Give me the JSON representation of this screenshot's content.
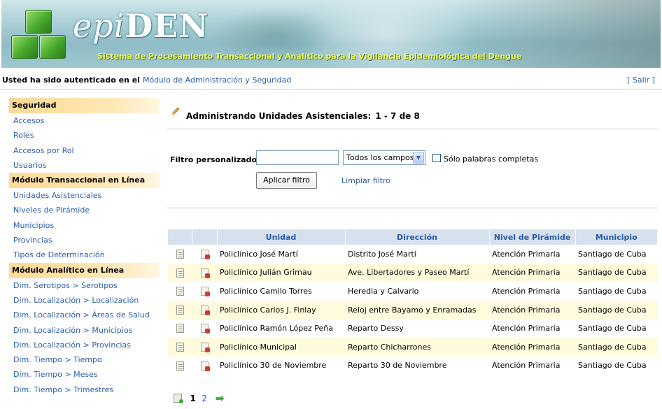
{
  "header": {
    "logo_prefix": "epi",
    "logo_suffix": "DEN",
    "subtitle": "Sistema de Procesamiento Transaccional y Analítico para la Vigilancia Epidemiológica del Dengue"
  },
  "auth": {
    "text": "Usted ha sido autenticado en el",
    "module": "Módulo de Administración y Seguridad",
    "logout": "[ Salir ]"
  },
  "sidebar": {
    "sections": [
      {
        "title": "Seguridad",
        "items": [
          "Accesos",
          "Roles",
          "Accesos por Rol",
          "Usuarios"
        ]
      },
      {
        "title": "Módulo Transaccional en Línea",
        "items": [
          "Unidades Asistenciales",
          "Niveles de Pirámide",
          "Municipios",
          "Provincias",
          "Tipos de Determinación"
        ]
      },
      {
        "title": "Módulo Analítico en Línea",
        "items": [
          "Dim. Serotipos > Serotipos",
          "Dim. Localización > Localización",
          "Dim. Localización > Áreas de Salud",
          "Dim. Localización > Municipios",
          "Dim. Localización > Provincias",
          "Dim. Tiempo > Tiempo",
          "Dim. Tiempo > Meses",
          "Dim. Tiempo > Trimestres"
        ]
      }
    ]
  },
  "main": {
    "title": "Administrando Unidades Asistenciales:",
    "range": "1 - 7 de 8",
    "filter": {
      "label": "Filtro personalizado",
      "input_value": "",
      "select_value": "Todos los campos",
      "checkbox_label": "Sólo palabras completas",
      "checkbox_checked": false,
      "apply": "Aplicar filtro",
      "clear": "Limpiar filtro"
    },
    "table": {
      "columns": [
        "Unidad",
        "Dirección",
        "Nivel de Pirámide",
        "Municipio"
      ],
      "rows": [
        [
          "Policlínico José Martí",
          "Distrito José Martí",
          "Atención Primaria",
          "Santiago de Cuba"
        ],
        [
          "Policlínico Julián Grimau",
          "Ave. Libertadores y Paseo Martí",
          "Atención Primaria",
          "Santiago de Cuba"
        ],
        [
          "Policlínico Camilo Torres",
          "Heredia y Calvario",
          "Atención Primaria",
          "Santiago de Cuba"
        ],
        [
          "Policlínico Carlos J. Finlay",
          "Reloj entre Bayamo y Enramadas",
          "Atención Primaria",
          "Santiago de Cuba"
        ],
        [
          "Policlínico Ramón López Peña",
          "Reparto Dessy",
          "Atención Primaria",
          "Santiago de Cuba"
        ],
        [
          "Policlínico Municipal",
          "Reparto Chicharrones",
          "Atención Primaria",
          "Santiago de Cuba"
        ],
        [
          "Policlínico 30 de Noviembre",
          "Reparto 30 de Noviembre",
          "Atención Primaria",
          "Santiago de Cuba"
        ]
      ]
    },
    "pager": {
      "current": "1",
      "pages": [
        "2"
      ]
    }
  },
  "colors": {
    "link": "#2a5ca8",
    "nav_header": "#ffd996",
    "table_header": "#d7e0ed",
    "row_alt": "#fffbdc",
    "subtitle": "#f4ff4a"
  },
  "icons": {
    "row_edit": "edit-icon",
    "row_delete": "delete-icon",
    "title": "pencil-icon",
    "pager_first": "new-record-icon",
    "pager_next": "next-arrow-icon"
  }
}
